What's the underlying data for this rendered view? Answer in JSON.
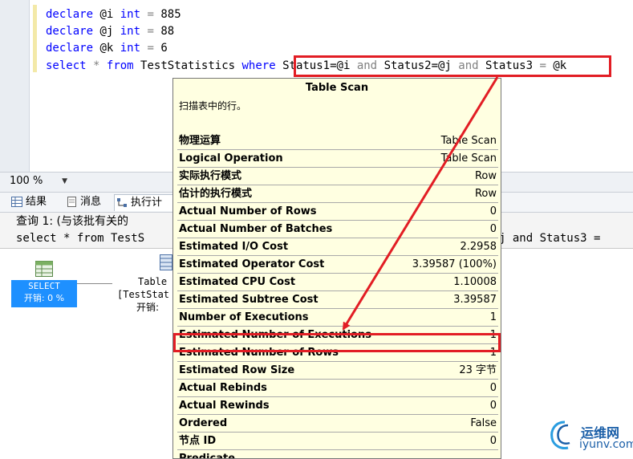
{
  "editor": {
    "lines": [
      {
        "kw": "declare",
        "var": "@i",
        "type": "int",
        "op": "=",
        "val": "885"
      },
      {
        "kw": "declare",
        "var": "@j",
        "type": "int",
        "op": "=",
        "val": "88"
      },
      {
        "kw": "declare",
        "var": "@k",
        "type": "int",
        "op": "=",
        "val": "6"
      }
    ],
    "select_line": {
      "select": "select",
      "star": "*",
      "from": "from",
      "table": "TestStatistics",
      "where": "where",
      "c1": "Status1=@i",
      "and1": "and",
      "c2": "Status2=@j",
      "and2": "and",
      "c3a": "Status3",
      "c3op": "=",
      "c3b": "@k"
    }
  },
  "zoom": {
    "value": "100 %"
  },
  "tabs": {
    "results": "结果",
    "messages": "消息",
    "plan": "执行计"
  },
  "results": {
    "query_line1": "查询 1: (与该批有关的",
    "query_line2a": "select * from TestS",
    "query_line2b": "j and Status3 =",
    "select_node": {
      "label": "SELECT",
      "cost": "开销: 0 %"
    },
    "table_node": {
      "line1": "Table",
      "line2": "[TestStat",
      "line3": "开销:"
    }
  },
  "tooltip": {
    "title": "Table Scan",
    "description": "扫描表中的行。",
    "rows": [
      {
        "k": "物理运算",
        "v": "Table Scan"
      },
      {
        "k": "Logical Operation",
        "v": "Table Scan"
      },
      {
        "k": "实际执行模式",
        "v": "Row"
      },
      {
        "k": "估计的执行模式",
        "v": "Row"
      },
      {
        "k": "Actual Number of Rows",
        "v": "0"
      },
      {
        "k": "Actual Number of Batches",
        "v": "0"
      },
      {
        "k": "Estimated I/O Cost",
        "v": "2.2958"
      },
      {
        "k": "Estimated Operator Cost",
        "v": "3.39587 (100%)"
      },
      {
        "k": "Estimated CPU Cost",
        "v": "1.10008"
      },
      {
        "k": "Estimated Subtree Cost",
        "v": "3.39587"
      },
      {
        "k": "Number of Executions",
        "v": "1"
      },
      {
        "k": "Estimated Number of Executions",
        "v": "1"
      },
      {
        "k": "Estimated Number of Rows",
        "v": "1"
      },
      {
        "k": "Estimated Row Size",
        "v": "23 字节"
      },
      {
        "k": "Actual Rebinds",
        "v": "0"
      },
      {
        "k": "Actual Rewinds",
        "v": "0"
      },
      {
        "k": "Ordered",
        "v": "False"
      },
      {
        "k": "节点 ID",
        "v": "0"
      }
    ],
    "predicate": "Predicate"
  },
  "watermark": {
    "cn": "运维网",
    "en": "iyunv.com"
  },
  "colors": {
    "highlight": "#e21d24",
    "keyword": "#0000ff",
    "tooltip_bg": "#ffffe1",
    "select_node": "#1e90ff"
  }
}
